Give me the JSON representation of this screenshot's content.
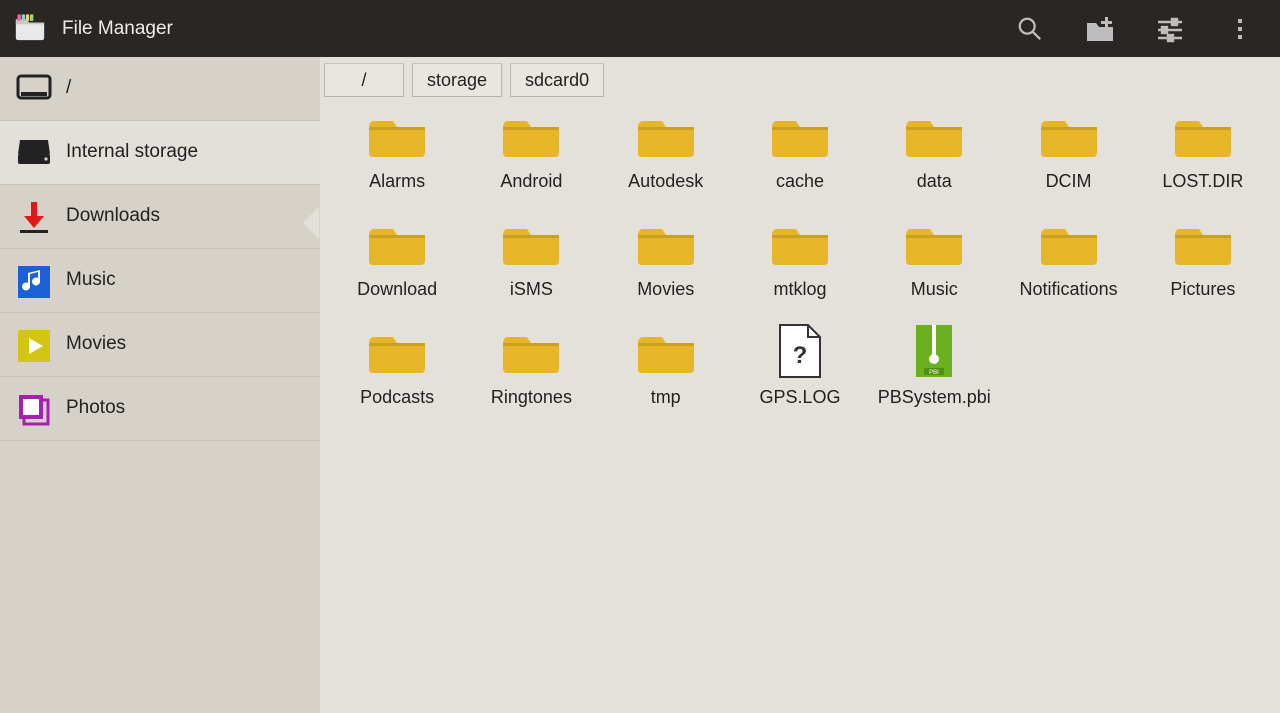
{
  "header": {
    "title": "File Manager"
  },
  "sidebar": {
    "items": [
      {
        "id": "root",
        "label": "/",
        "icon": "sd-icon"
      },
      {
        "id": "internal",
        "label": "Internal storage",
        "icon": "disk-icon",
        "selected": true
      },
      {
        "id": "downloads",
        "label": "Downloads",
        "icon": "download-icon"
      },
      {
        "id": "music",
        "label": "Music",
        "icon": "music-icon"
      },
      {
        "id": "movies",
        "label": "Movies",
        "icon": "movies-icon"
      },
      {
        "id": "photos",
        "label": "Photos",
        "icon": "photos-icon"
      }
    ]
  },
  "breadcrumbs": [
    "/",
    "storage",
    "sdcard0"
  ],
  "entries": [
    {
      "name": "Alarms",
      "type": "folder"
    },
    {
      "name": "Android",
      "type": "folder"
    },
    {
      "name": "Autodesk",
      "type": "folder"
    },
    {
      "name": "cache",
      "type": "folder"
    },
    {
      "name": "data",
      "type": "folder"
    },
    {
      "name": "DCIM",
      "type": "folder"
    },
    {
      "name": "LOST.DIR",
      "type": "folder"
    },
    {
      "name": "Download",
      "type": "folder"
    },
    {
      "name": "iSMS",
      "type": "folder"
    },
    {
      "name": "Movies",
      "type": "folder"
    },
    {
      "name": "mtklog",
      "type": "folder"
    },
    {
      "name": "Music",
      "type": "folder"
    },
    {
      "name": "Notifications",
      "type": "folder"
    },
    {
      "name": "Pictures",
      "type": "folder"
    },
    {
      "name": "Podcasts",
      "type": "folder"
    },
    {
      "name": "Ringtones",
      "type": "folder"
    },
    {
      "name": "tmp",
      "type": "folder"
    },
    {
      "name": "GPS.LOG",
      "type": "file-unknown"
    },
    {
      "name": "PBSystem.pbi",
      "type": "file-archive"
    }
  ],
  "colors": {
    "folder": "#e7b52a",
    "archive": "#6bb11f",
    "accentBlue": "#1d5fd6",
    "accentYellow": "#d2c513",
    "accentPurple": "#a61fb0",
    "accentRed": "#e01818"
  }
}
